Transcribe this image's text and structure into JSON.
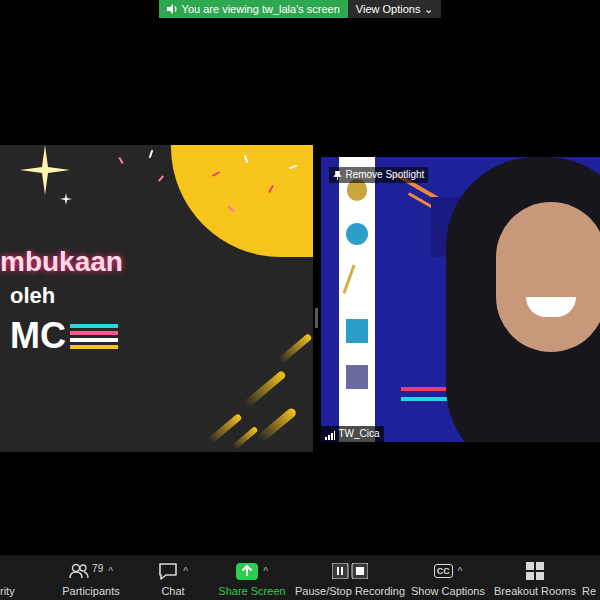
{
  "banner": {
    "text": "You are viewing tw_lala's screen",
    "view_options": "View Options",
    "chevron": "⌄"
  },
  "slide": {
    "title": "mbukaan",
    "subtitle": "oleh",
    "host": "MC"
  },
  "video": {
    "spotlight": "Remove Spotlight",
    "name": "TW_Cica"
  },
  "toolbar": [
    {
      "label": "rity",
      "kind": "cut",
      "active": false
    },
    {
      "label": "Participants",
      "kind": "participants",
      "count": "79",
      "caret": "^",
      "active": false
    },
    {
      "label": "Chat",
      "kind": "chat",
      "caret": "^",
      "active": false
    },
    {
      "label": "Share Screen",
      "kind": "share",
      "caret": "^",
      "active": true
    },
    {
      "label": "Pause/Stop Recording",
      "kind": "recording",
      "active": false
    },
    {
      "label": "Show Captions",
      "kind": "captions",
      "icon_text": "CC",
      "caret": "^",
      "active": false
    },
    {
      "label": "Breakout Rooms",
      "kind": "breakout",
      "active": false
    },
    {
      "label": "Re",
      "kind": "cut",
      "active": false
    }
  ]
}
